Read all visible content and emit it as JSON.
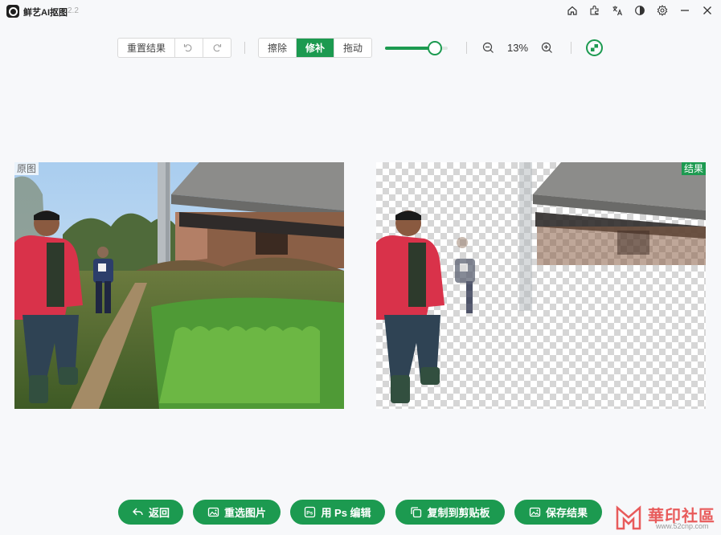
{
  "app": {
    "name": "鲜艺AI抠图",
    "version": "2.2"
  },
  "window_controls": [
    "home-icon",
    "plugin-icon",
    "translate-icon",
    "theme-icon",
    "settings-icon",
    "minimize-icon",
    "close-icon"
  ],
  "toolbar": {
    "reset_label": "重置结果",
    "undo_icon": "undo-icon",
    "redo_icon": "redo-icon",
    "modes": [
      {
        "label": "擦除",
        "active": false
      },
      {
        "label": "修补",
        "active": true
      },
      {
        "label": "拖动",
        "active": false
      }
    ],
    "brush_size_fraction": 0.8,
    "zoom_out_icon": "zoom-out-icon",
    "zoom_level": "13%",
    "zoom_in_icon": "zoom-in-icon",
    "background_toggle_icon": "checkerboard-icon"
  },
  "panels": {
    "original_tag": "原图",
    "result_tag": "结果"
  },
  "actions": [
    {
      "label": "返回",
      "icon": "back-icon"
    },
    {
      "label": "重选图片",
      "icon": "image-icon"
    },
    {
      "label": "用 Ps 编辑",
      "icon": "ps-icon"
    },
    {
      "label": "复制到剪贴板",
      "icon": "copy-icon"
    },
    {
      "label": "保存结果",
      "icon": "save-image-icon"
    }
  ],
  "watermark": {
    "text": "華印社區",
    "url": "www.52cnp.com"
  },
  "colors": {
    "accent": "#1c9a50",
    "jacket": "#d9324a"
  }
}
